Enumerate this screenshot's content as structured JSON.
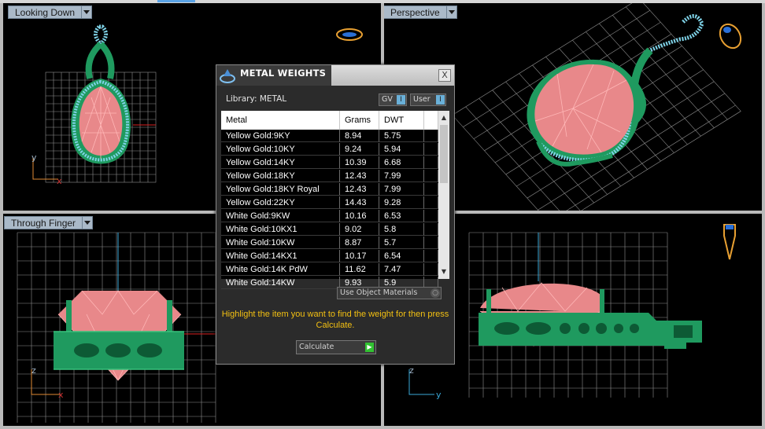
{
  "viewports": {
    "top_left": {
      "label": "Looking Down"
    },
    "top_right": {
      "label": "Perspective"
    },
    "bottom_left": {
      "label": "Through Finger"
    },
    "bottom_right": {
      "label": ""
    }
  },
  "axes": {
    "tl_vertical": "y",
    "tl_horizontal": "x",
    "bl_vertical": "z",
    "bl_horizontal": "x",
    "br_vertical": "z",
    "br_horizontal": "y"
  },
  "dialog": {
    "title": "METAL WEIGHTS",
    "close_label": "X",
    "library_label": "Library: METAL",
    "gv_toggle": "GV",
    "user_toggle": "User",
    "columns": [
      "Metal",
      "Grams",
      "DWT"
    ],
    "rows": [
      [
        "Yellow Gold:9KY",
        "8.94",
        "5.75"
      ],
      [
        "Yellow Gold:10KY",
        "9.24",
        "5.94"
      ],
      [
        "Yellow Gold:14KY",
        "10.39",
        "6.68"
      ],
      [
        "Yellow Gold:18KY",
        "12.43",
        "7.99"
      ],
      [
        "Yellow Gold:18KY Royal",
        "12.43",
        "7.99"
      ],
      [
        "Yellow Gold:22KY",
        "14.43",
        "9.28"
      ],
      [
        "White Gold:9KW",
        "10.16",
        "6.53"
      ],
      [
        "White Gold:10KX1",
        "9.02",
        "5.8"
      ],
      [
        "White Gold:10KW",
        "8.87",
        "5.7"
      ],
      [
        "White Gold:14KX1",
        "10.17",
        "6.54"
      ],
      [
        "White Gold:14K PdW",
        "11.62",
        "7.47"
      ],
      [
        "White Gold:14KW",
        "9.93",
        "5.9"
      ]
    ],
    "use_object_materials": "Use Object Materials",
    "instruction": "Highlight the item you want to find the weight for then press Calculate.",
    "calculate_label": "Calculate"
  },
  "colors": {
    "gem": "#e8888a",
    "gem_line": "#ffb7b7",
    "metal": "#1f9a5f",
    "diamonds": "#7fd3e8",
    "grid": "#9a9a9a",
    "accent": "#f3c012"
  },
  "icons": {
    "logo": "ring-logo-icon",
    "close": "close-icon",
    "view_cube": "ring-view-icon"
  }
}
